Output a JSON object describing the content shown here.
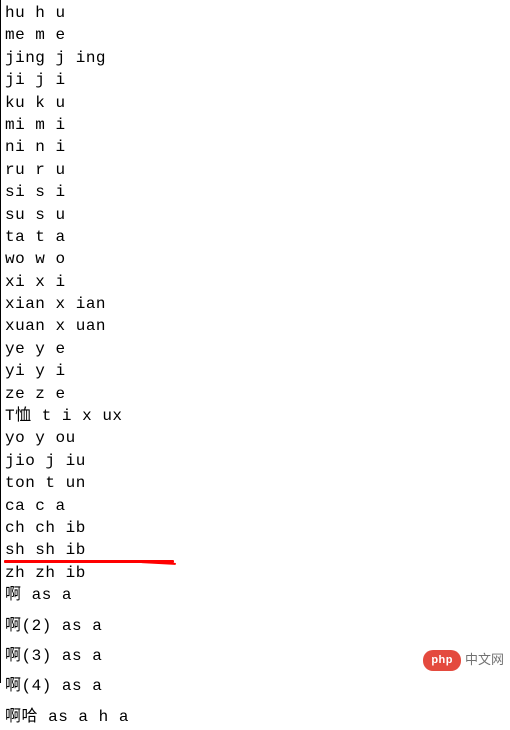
{
  "lines": [
    {
      "text": "hu h u",
      "spaced": false
    },
    {
      "text": "me m e",
      "spaced": false
    },
    {
      "text": "jing j ing",
      "spaced": false
    },
    {
      "text": "ji j i",
      "spaced": false
    },
    {
      "text": "ku k u",
      "spaced": false
    },
    {
      "text": "mi m i",
      "spaced": false
    },
    {
      "text": "ni n i",
      "spaced": false
    },
    {
      "text": "ru r u",
      "spaced": false
    },
    {
      "text": "si s i",
      "spaced": false
    },
    {
      "text": "su s u",
      "spaced": false
    },
    {
      "text": "ta t a",
      "spaced": false
    },
    {
      "text": "wo w o",
      "spaced": false
    },
    {
      "text": "xi x i",
      "spaced": false
    },
    {
      "text": "xian x ian",
      "spaced": false
    },
    {
      "text": "xuan x uan",
      "spaced": false
    },
    {
      "text": "ye y e",
      "spaced": false
    },
    {
      "text": "yi y i",
      "spaced": false
    },
    {
      "text": "ze z e",
      "spaced": false
    },
    {
      "text": "T恤 t i x ux",
      "spaced": false
    },
    {
      "text": "yo y ou",
      "spaced": false
    },
    {
      "text": "jio j iu",
      "spaced": false
    },
    {
      "text": "ton t un",
      "spaced": false
    },
    {
      "text": "ca c a",
      "spaced": false
    },
    {
      "text": "ch ch ib",
      "spaced": false
    },
    {
      "text": "sh sh ib",
      "spaced": false
    },
    {
      "text": "zh zh ib",
      "spaced": false
    },
    {
      "text": "啊 as a",
      "spaced": true
    },
    {
      "text": "啊(2) as a",
      "spaced": true
    },
    {
      "text": "啊(3) as a",
      "spaced": true
    },
    {
      "text": "啊(4) as a",
      "spaced": true
    },
    {
      "text": "啊哈 as a h a",
      "spaced": false
    }
  ],
  "watermark": {
    "badge": "php",
    "text": "中文网"
  }
}
